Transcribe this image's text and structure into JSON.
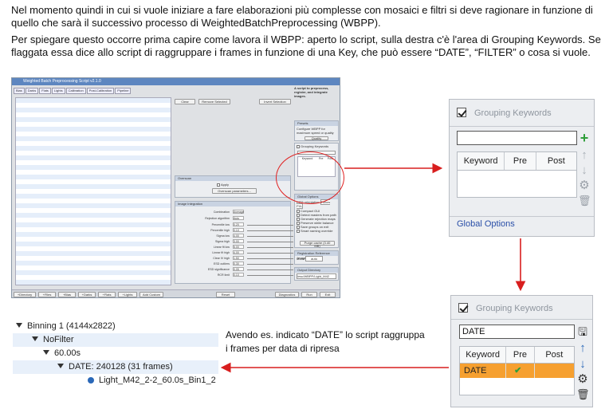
{
  "intro": {
    "p1": "Nel momento quindi in cui si vuole iniziare a fare elaborazioni più complesse con mosaici e filtri si deve ragionare in funzione di quello che sarà il successivo processo di WeightedBatchPreprocessing (WBPP).",
    "p2": "Per spiegare questo occorre prima capire come lavora il WBPP: aperto lo script, sulla destra c'è l'area di Grouping Keywords. Se flaggata essa dice allo script di raggruppare i frames in funzione di una Key, che può essere “DATE”, “FILTER” o cosa si vuole."
  },
  "wbpp": {
    "title": "Weighted Batch Preprocessing Script v2.1.0",
    "tabs": [
      "Bias",
      "Darks",
      "Flats",
      "Lights",
      "Calibration",
      "Post-Calibration",
      "Pipeline"
    ],
    "buttons": {
      "clear": "Clear",
      "remove_selected": "Remove Selected",
      "invert_selection": "Invert Selection",
      "apply": "Apply",
      "overscan_params": "Overscan parameters...",
      "purge": "Purge cache (3.40 MB)",
      "diagnostics": "Diagnostics",
      "run": "Run",
      "exit": "Exit",
      "reset": "Reset"
    },
    "bottom_buttons": [
      "+Directory",
      "+Files",
      "+Bias",
      "+Darks",
      "+Flats",
      "+Lights",
      "Add Custom"
    ],
    "overscan_title": "Overscan",
    "image_integration_title": "Image Integration",
    "ii_fields": [
      {
        "label": "Combination",
        "value": "Average"
      },
      {
        "label": "Rejection algorithm",
        "value": "Auto"
      },
      {
        "label": "Percentile low",
        "value": "0.20"
      },
      {
        "label": "Percentile high",
        "value": "0.10"
      },
      {
        "label": "Sigma low",
        "value": "4.00"
      },
      {
        "label": "Sigma high",
        "value": "3.00"
      },
      {
        "label": "Linear fit low",
        "value": "5.00"
      },
      {
        "label": "Linear fit high",
        "value": "4.00"
      },
      {
        "label": "Clear IV high",
        "value": "1.50"
      },
      {
        "label": "ESD outliers",
        "value": "0.30"
      },
      {
        "label": "ESD significance",
        "value": "0.05"
      },
      {
        "label": "RCR limit",
        "value": "0.10"
      }
    ],
    "right": {
      "intro": "A script to preprocess, register, and integrate images.",
      "presets_title": "Presets",
      "presets_text": "Configure WBPP for maximum speed or quality",
      "presets_btn": "Quality",
      "grouping_title": "Grouping Keywords",
      "grouping_cols": [
        "Keyword",
        "Pre",
        "Post"
      ],
      "global_title": "Global Options",
      "fits_label": "FITS orientation",
      "fits_value": "Follow PI/L",
      "global_checks": [
        "Compact GUI",
        "Detect masters from path",
        "Generate rejection maps",
        "Preserve white balance",
        "Save groups on exit",
        "Smart naming override"
      ],
      "registration_title": "Registration Reference Image",
      "mode_label": "Mode",
      "mode_value": "auto",
      "output_title": "Output Directory",
      "output_value": "/esc/WBPP/Light_M42"
    }
  },
  "zoom1": {
    "grouping_title": "Grouping Keywords",
    "keyword_value": "",
    "columns": [
      "Keyword",
      "Pre",
      "Post"
    ],
    "global_options": "Global Options",
    "icons": [
      "plus-icon",
      "arrow-up-icon",
      "arrow-down-icon",
      "gear-icon",
      "trash-icon"
    ]
  },
  "zoom2": {
    "grouping_title": "Grouping Keywords",
    "keyword_value": "DATE",
    "columns": [
      "Keyword",
      "Pre",
      "Post"
    ],
    "row": {
      "keyword": "DATE",
      "pre": "✔",
      "post": ""
    },
    "icons": [
      "save-icon",
      "arrow-up-icon",
      "arrow-down-icon",
      "gear-icon",
      "trash-icon"
    ]
  },
  "tree": {
    "rows": [
      {
        "label": "Binning 1 (4144x2822)",
        "expanded": true
      },
      {
        "label": "NoFilter",
        "expanded": true
      },
      {
        "label": "60.00s",
        "expanded": true
      },
      {
        "label": "DATE: 240128 (31 frames)",
        "expanded": true
      },
      {
        "label": "Light_M42_2-2_60.0s_Bin1_2",
        "leaf": true
      }
    ]
  },
  "caption": "Avendo es. indicato “DATE” lo script raggruppa i frames per data di ripresa",
  "colors": {
    "arrow": "#d81e1e",
    "selected_row": "#f6a030",
    "accent_green": "#2f9e3a",
    "accent_blue": "#2a68b8"
  }
}
